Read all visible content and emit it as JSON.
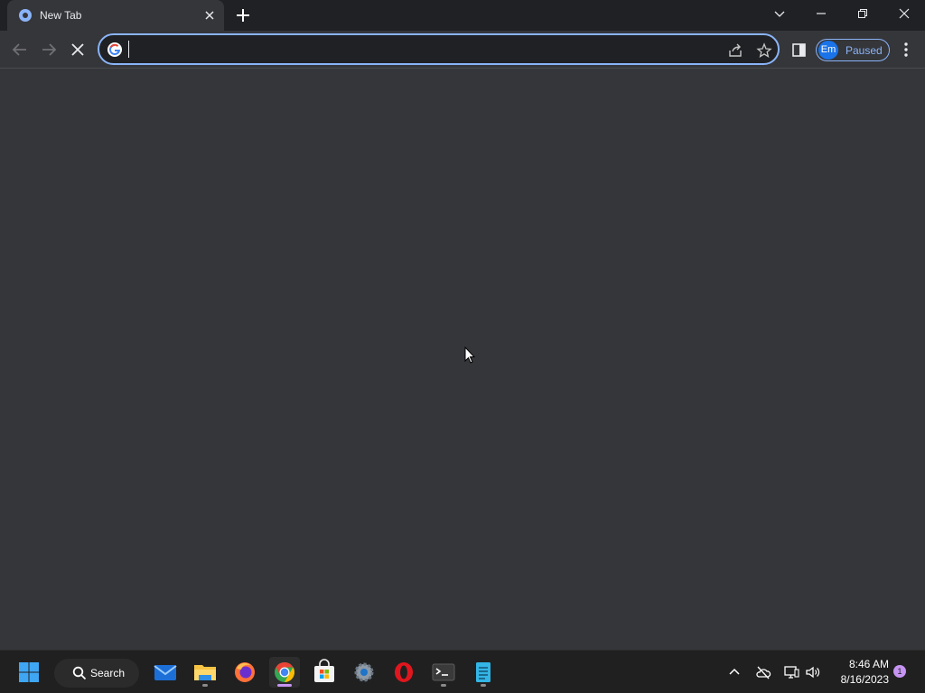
{
  "window": {
    "tab_title": "New Tab",
    "tab_favicon_icon": "chrome-icon",
    "newtab_icon": "plus-icon",
    "controls": [
      "chevron-down-icon",
      "minimize-icon",
      "restore-icon",
      "close-icon"
    ]
  },
  "toolbar": {
    "omnibox_value": "",
    "omnibox_placeholder": "",
    "profile_initials": "Em",
    "profile_status": "Paused",
    "accent_color": "#8ab4f8"
  },
  "taskbar": {
    "search_label": "Search",
    "apps": [
      "start",
      "search",
      "mail",
      "file-explorer",
      "firefox",
      "chrome",
      "microsoft-store",
      "settings",
      "opera",
      "terminal",
      "notepad"
    ],
    "clock_time": "8:46 AM",
    "clock_date": "8/16/2023",
    "notification_count": "1"
  }
}
